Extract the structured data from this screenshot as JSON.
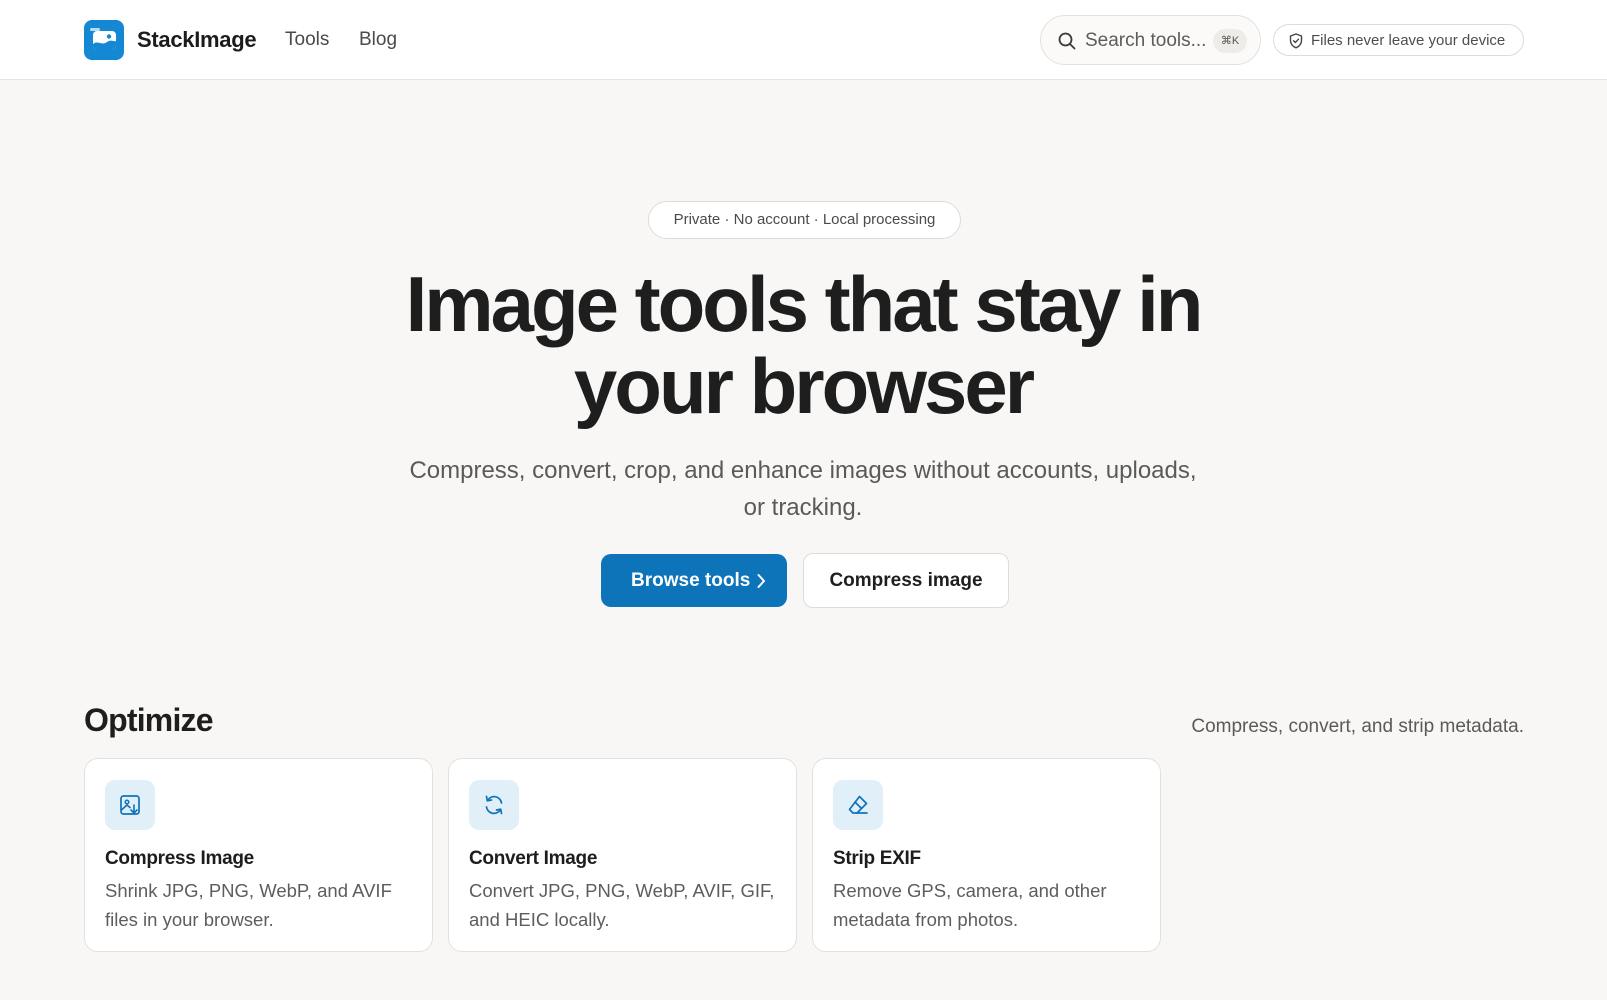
{
  "header": {
    "brand": "StackImage",
    "nav": [
      {
        "label": "Tools"
      },
      {
        "label": "Blog"
      }
    ],
    "search": {
      "placeholder": "Search tools...",
      "shortcut": "⌘K"
    },
    "trust_badge": "Files never leave your device"
  },
  "hero": {
    "pill": "Private · No account · Local processing",
    "title_line1": "Image tools that stay in",
    "title_line2": "your browser",
    "subtitle": "Compress, convert, crop, and enhance images without accounts, uploads, or tracking.",
    "primary_button": "Browse tools",
    "secondary_button": "Compress image"
  },
  "section": {
    "title": "Optimize",
    "subtitle": "Compress, convert, and strip metadata.",
    "cards": [
      {
        "icon": "image-compress-icon",
        "title": "Compress Image",
        "description": "Shrink JPG, PNG, WebP, and AVIF files in your browser."
      },
      {
        "icon": "refresh-icon",
        "title": "Convert Image",
        "description": "Convert JPG, PNG, WebP, AVIF, GIF, and HEIC locally."
      },
      {
        "icon": "eraser-icon",
        "title": "Strip EXIF",
        "description": "Remove GPS, camera, and other metadata from photos."
      }
    ]
  },
  "colors": {
    "accent": "#0e74ba",
    "logo": "#1588d4",
    "icon_tile": "#e1eff9",
    "background": "#f8f7f5"
  }
}
